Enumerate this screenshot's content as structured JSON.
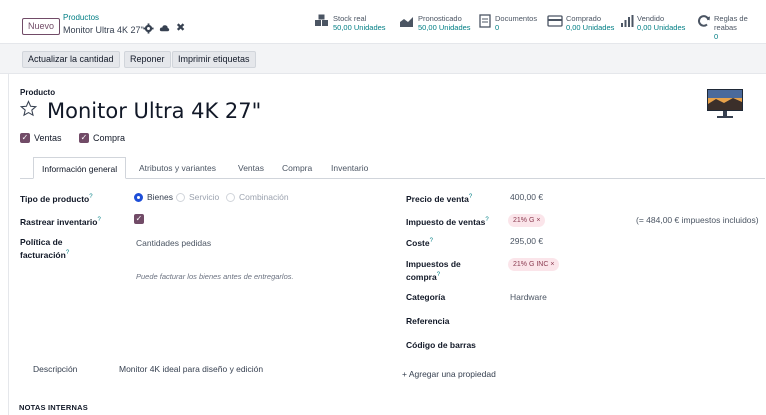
{
  "topbar": {
    "new_label": "Nuevo",
    "breadcrumb_parent": "Productos",
    "breadcrumb_current": "Monitor Ultra 4K 27\"",
    "smart_buttons": [
      {
        "label": "Stock real",
        "value": "50,00 Unidades",
        "icon": "boxes-icon"
      },
      {
        "label": "Pronosticado",
        "value": "50,00 Unidades",
        "icon": "area-chart-icon"
      },
      {
        "label": "Documentos",
        "value": "0",
        "icon": "document-icon"
      },
      {
        "label": "Comprado",
        "value": "0,00 Unidades",
        "icon": "credit-card-icon"
      },
      {
        "label": "Vendido",
        "value": "0,00 Unidades",
        "icon": "bar-chart-icon"
      },
      {
        "label": "Reglas de reabas",
        "value": "0",
        "icon": "refresh-icon"
      }
    ]
  },
  "actions": {
    "update_qty": "Actualizar la cantidad",
    "replenish": "Reponer",
    "print_labels": "Imprimir etiquetas"
  },
  "product": {
    "label": "Producto",
    "name": "Monitor Ultra 4K 27\"",
    "sales_label": "Ventas",
    "purchase_label": "Compra"
  },
  "tabs": [
    "Información general",
    "Atributos y variantes",
    "Ventas",
    "Compra",
    "Inventario"
  ],
  "left": {
    "product_type_label": "Tipo de producto",
    "product_type_options": [
      "Bienes",
      "Servicio",
      "Combinación"
    ],
    "track_inventory_label": "Rastrear inventario",
    "invoicing_policy_label_1": "Política de",
    "invoicing_policy_label_2": "facturación",
    "invoicing_policy_value": "Cantidades pedidas",
    "invoicing_help": "Puede facturar los bienes antes de entregarlos.",
    "description_label": "Descripción",
    "description_value": "Monitor 4K ideal para diseño y edición"
  },
  "right": {
    "sale_price_label": "Precio de venta",
    "sale_price_value": "400,00 €",
    "sales_tax_label": "Impuesto de ventas",
    "sales_tax_tag": "21% G ×",
    "tax_included_note": "(= 484,00 € impuestos incluidos)",
    "cost_label": "Coste",
    "cost_value": "295,00 €",
    "purchase_tax_label_1": "Impuestos de",
    "purchase_tax_label_2": "compra",
    "purchase_tax_tag": "21% G INC ×",
    "category_label": "Categoría",
    "category_value": "Hardware",
    "reference_label": "Referencia",
    "barcode_label": "Código de barras",
    "add_property": "+ Agregar una propiedad"
  },
  "notes_label": "NOTAS INTERNAS",
  "colors": {
    "brand": "#714b67",
    "link": "#017e84",
    "radio": "#1d4ed8",
    "tag_bg": "#fbe5ea"
  }
}
